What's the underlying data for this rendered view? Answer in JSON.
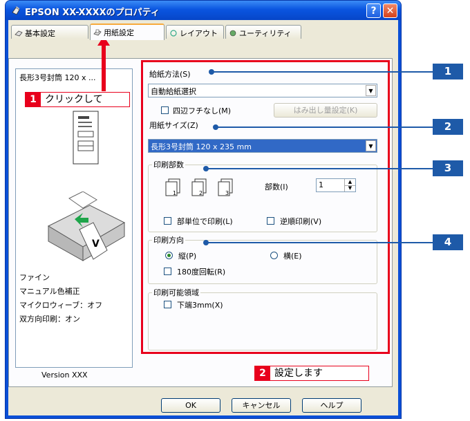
{
  "window": {
    "title": "EPSON XX-XXXXのプロパティ",
    "help_label": "?",
    "close_label": "✕"
  },
  "tabs": [
    {
      "label": "基本設定"
    },
    {
      "label": "用紙設定"
    },
    {
      "label": "レイアウト"
    },
    {
      "label": "ユーティリティ"
    }
  ],
  "left": {
    "paper_preview": "長形3号封筒 120 x ...",
    "status_lines": [
      "ファイン",
      "マニュアル色補正",
      "マイクロウィーブ：オフ",
      "双方向印刷：オン"
    ],
    "version": "Version XXX"
  },
  "paper_source": {
    "group_label": "給紙方法(S)",
    "selected": "自動給紙選択",
    "borderless_label": "四辺フチなし(M)",
    "overflow_button": "はみ出し量設定(K)"
  },
  "paper_size": {
    "label": "用紙サイズ(Z)",
    "selected": "長形3号封筒 120 x 235 mm"
  },
  "copies": {
    "group_label": "印刷部数",
    "count_label": "部数(I)",
    "count_value": "1",
    "collate_label": "部単位で印刷(L)",
    "reverse_label": "逆順印刷(V)",
    "collate_icons": [
      "1",
      "2",
      "3"
    ]
  },
  "orientation": {
    "group_label": "印刷方向",
    "portrait_label": "縦(P)",
    "landscape_label": "横(E)",
    "rotate_label": "180度回転(R)",
    "selected": "portrait"
  },
  "printable_area": {
    "group_label": "印刷可能領域",
    "bottom_label": "下端3mm(X)"
  },
  "buttons": {
    "ok": "OK",
    "cancel": "キャンセル",
    "help": "ヘルプ"
  },
  "annotations": {
    "click_num": "1",
    "click_text": "クリックして",
    "set_num": "2",
    "set_text": "設定します",
    "callouts": [
      "1",
      "2",
      "3",
      "4"
    ]
  },
  "colors": {
    "accent_red": "#e8001c",
    "callout_blue": "#1e5aa8",
    "titlebar_blue": "#0a55e0"
  }
}
